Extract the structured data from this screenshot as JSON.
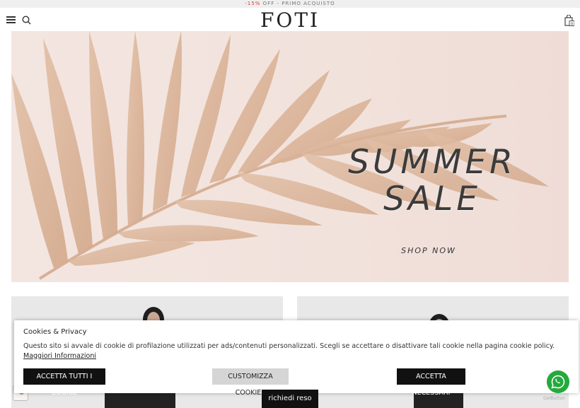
{
  "promo": {
    "prefix": "-15%",
    "text": " OFF - PRIMO ACQUISTO"
  },
  "header": {
    "logo": "FOTI",
    "cart_count": "0"
  },
  "hero": {
    "title_line1": "SUMMER",
    "title_line2": "SALE",
    "cta": "SHOP NOW"
  },
  "cookie": {
    "title": "Cookies & Privacy",
    "text": "Questo sito si avvale di cookie di profilazione utilizzati per ads/contenuti personalizzati. Scegli se accettare o disattivare tali cookie nella pagina cookie policy. ",
    "more_link": "Maggiori Informazioni",
    "accept_all": "ACCETTA TUTTI I COOKIE",
    "customize": "CUSTOMIZZA COOKIES",
    "accept_necessary": "ACCETTA NECESSARI"
  },
  "floating": {
    "return_label": "richiedi reso",
    "getbutton": "GetButton"
  },
  "colors": {
    "promo_highlight": "#d43b3b",
    "whatsapp": "#25a93c",
    "hero_bg": "#f2e2dc"
  }
}
